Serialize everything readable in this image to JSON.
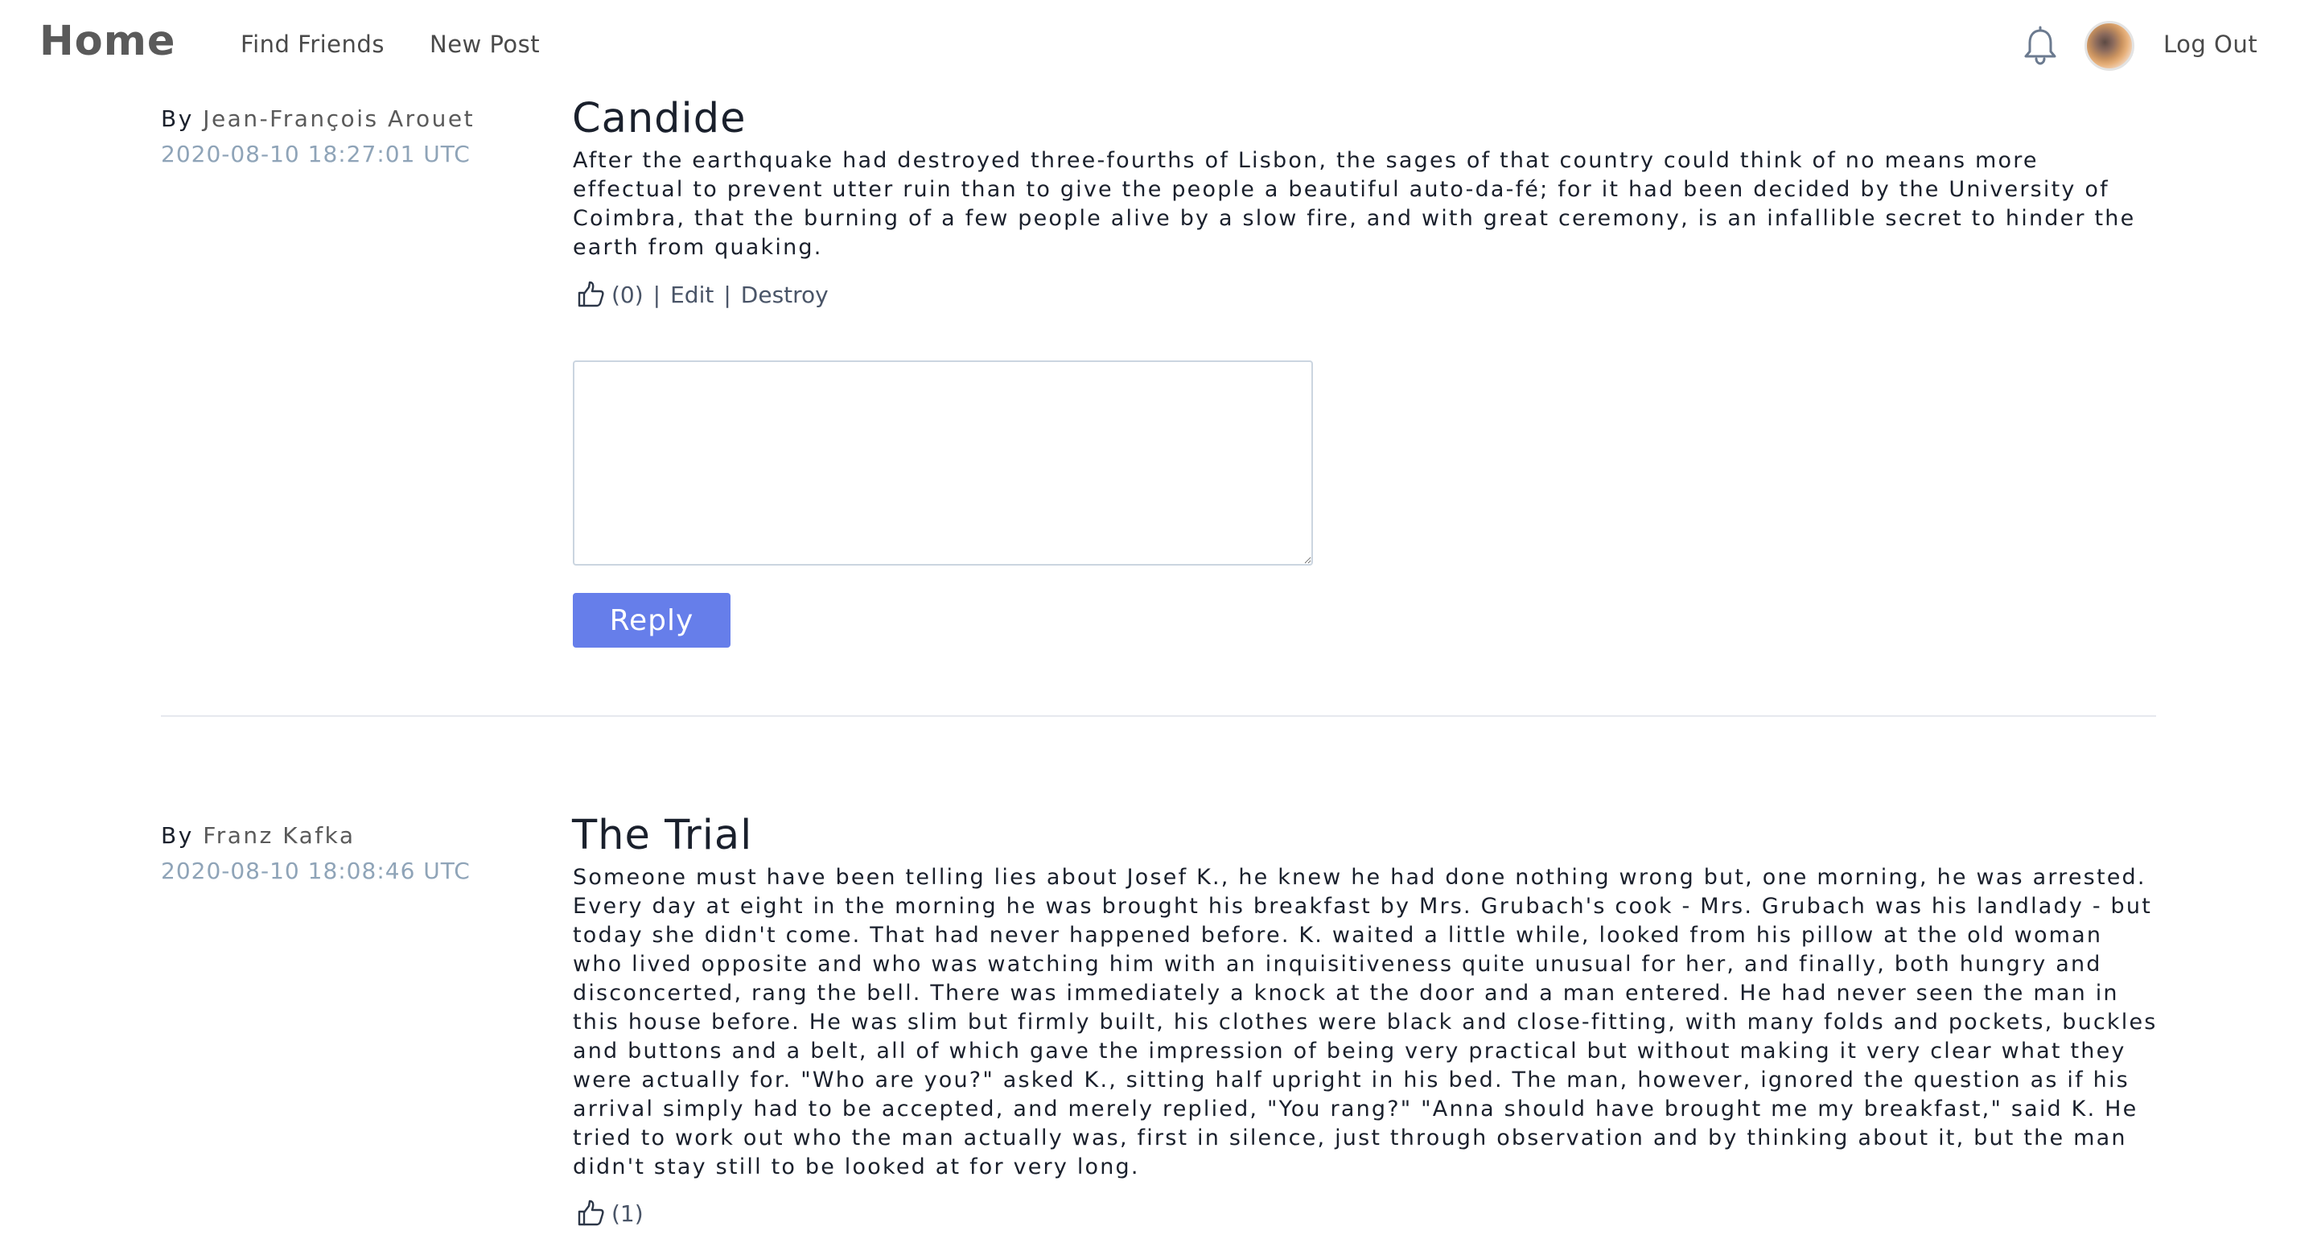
{
  "nav": {
    "brand": "Home",
    "find_friends": "Find Friends",
    "new_post": "New Post",
    "logout": "Log Out"
  },
  "posts": [
    {
      "by_label": "By",
      "author": "Jean-François Arouet",
      "timestamp": "2020-08-10 18:27:01 UTC",
      "title": "Candide",
      "body": "After the earthquake had destroyed three-fourths of Lisbon, the sages of that country could think of no means more effectual to prevent utter ruin than to give the people a beautiful auto-da-fé; for it had been decided by the University of Coimbra, that the burning of a few people alive by a slow fire, and with great ceremony, is an infallible secret to hinder the earth from quaking.",
      "likes": "(0)",
      "edit_label": "Edit",
      "destroy_label": "Destroy",
      "separator": "|",
      "reply_label": "Reply"
    },
    {
      "by_label": "By",
      "author": "Franz Kafka",
      "timestamp": "2020-08-10 18:08:46 UTC",
      "title": "The Trial",
      "body": "Someone must have been telling lies about Josef K., he knew he had done nothing wrong but, one morning, he was arrested. Every day at eight in the morning he was brought his breakfast by Mrs. Grubach's cook - Mrs. Grubach was his landlady - but today she didn't come. That had never happened before. K. waited a little while, looked from his pillow at the old woman who lived opposite and who was watching him with an inquisitiveness quite unusual for her, and finally, both hungry and disconcerted, rang the bell. There was immediately a knock at the door and a man entered. He had never seen the man in this house before. He was slim but firmly built, his clothes were black and close-fitting, with many folds and pockets, buckles and buttons and a belt, all of which gave the impression of being very practical but without making it very clear what they were actually for. \"Who are you?\" asked K., sitting half upright in his bed. The man, however, ignored the question as if his arrival simply had to be accepted, and merely replied, \"You rang?\" \"Anna should have brought me my breakfast,\" said K. He tried to work out who the man actually was, first in silence, just through observation and by thinking about it, but the man didn't stay still to be looked at for very long.",
      "likes": "(1)"
    }
  ],
  "icons": {
    "notifications": "bell-icon",
    "like": "thumbs-up-icon",
    "avatar": "user-avatar"
  },
  "colors": {
    "accent": "#667eea",
    "timestamp": "#8fa4b8",
    "text": "#1a202c",
    "muted": "#4a5568"
  }
}
